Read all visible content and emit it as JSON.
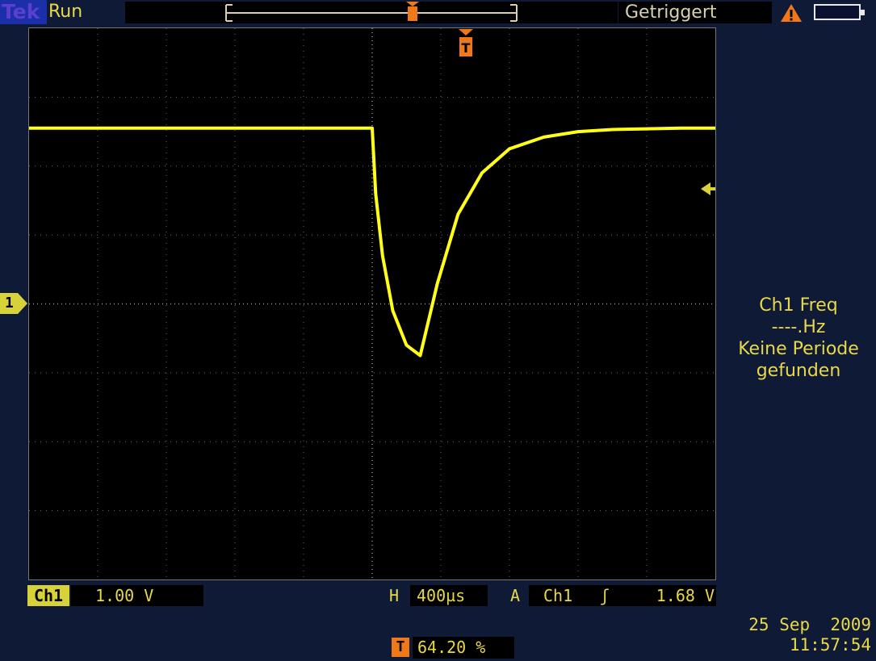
{
  "header": {
    "brand": "Tek",
    "run_state": "Run",
    "trigger_status": "Getriggert"
  },
  "side_readout": {
    "line1": "Ch1 Freq",
    "line2": "----.Hz",
    "line3": "Keine Periode",
    "line4": "gefunden"
  },
  "channel": {
    "tag": "Ch1",
    "scale": "1.00 V",
    "marker": "1"
  },
  "horizontal": {
    "label": "H",
    "scale": "400µs"
  },
  "trigger": {
    "mode_label": "A",
    "source": "Ch1",
    "edge_symbol": "ʃ",
    "level": "1.68 V",
    "position_icon": "T",
    "position": "64.20 %"
  },
  "datetime": {
    "date": "25 Sep  2009",
    "time": "11:57:54"
  },
  "colors": {
    "trace": "#ffff1a",
    "text": "#e8d84a",
    "trigger_marker": "#f07818",
    "background": "#0e1a36"
  },
  "icons": {
    "warning": "warning-triangle-icon",
    "battery": "battery-icon",
    "trigger": "trigger-marker-icon"
  },
  "chart_data": {
    "type": "line",
    "title": "",
    "xlabel": "",
    "ylabel": "",
    "x_unit": "divisions",
    "y_unit": "V",
    "xlim": [
      0,
      10
    ],
    "ylim": [
      -4,
      4
    ],
    "series": [
      {
        "x": [
          0,
          0.5,
          1,
          2,
          3,
          4,
          5.0,
          5.05,
          5.15,
          5.3,
          5.5,
          5.7,
          5.95,
          6.25,
          6.6,
          7.0,
          7.5,
          8.0,
          8.5,
          9.0,
          9.5,
          10
        ],
        "y": [
          2.55,
          2.55,
          2.55,
          2.55,
          2.55,
          2.55,
          2.55,
          1.6,
          0.7,
          -0.1,
          -0.6,
          -0.75,
          0.3,
          1.3,
          1.9,
          2.25,
          2.42,
          2.5,
          2.53,
          2.54,
          2.55,
          2.55
        ]
      }
    ]
  }
}
